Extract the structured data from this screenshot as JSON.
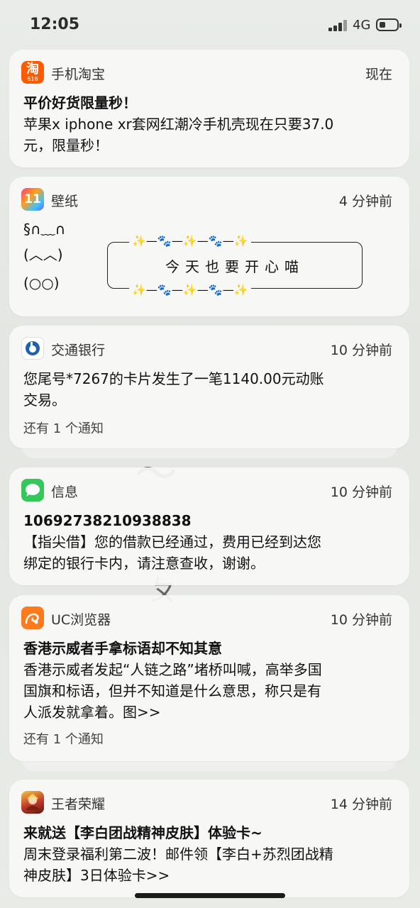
{
  "status_bar": {
    "time": "12:05",
    "network": "4G"
  },
  "notifications": [
    {
      "app": "手机淘宝",
      "time": "现在",
      "icon_glyph": "淘",
      "icon_sub": "618",
      "icon_color": "#ff5a00",
      "title": "平价好货限量秒！",
      "body": [
        "苹果x iphone xr套网红潮冷手机壳现在只要37.0",
        "元，限量秒！"
      ]
    },
    {
      "app": "壁纸",
      "time": "4 分钟前",
      "icon_glyph": "11",
      "kaomoji_lines": [
        "§∩﹏∩",
        "(︿︿)",
        "(○○)"
      ],
      "banner_text": "今天也要开心喵",
      "banner_deco": "✨—🐾—✨—🐾—✨"
    },
    {
      "app": "交通银行",
      "time": "10 分钟前",
      "icon_color": "#1e5fae",
      "body": [
        "您尾号*7267的卡片发生了一笔1140.00元动账",
        "交易。"
      ],
      "more": "还有 1 个通知"
    },
    {
      "app": "信息",
      "time": "10 分钟前",
      "icon_color": "#34c759",
      "title": "10692738210938838",
      "body": [
        "【指尖借】您的借款已经通过，费用已经到达您",
        "绑定的银行卡内，请注意查收，谢谢。"
      ]
    },
    {
      "app": "UC浏览器",
      "time": "10 分钟前",
      "icon_color": "#ff7a1a",
      "title": "香港示威者手拿标语却不知其意",
      "body": [
        "香港示威者发起“人链之路”堵桥叫喊，高举多国",
        "国旗和标语，但并不知道是什么意思，称只是有",
        "人派发就拿着。图>>"
      ],
      "more": "还有 1 个通知"
    },
    {
      "app": "王者荣耀",
      "time": "14 分钟前",
      "title": "来就送【李白团战精神皮肤】体验卡~",
      "body": [
        "周末登录福利第二波！邮件领【李白+苏烈团战精",
        "神皮肤】3日体验卡>>"
      ]
    }
  ]
}
